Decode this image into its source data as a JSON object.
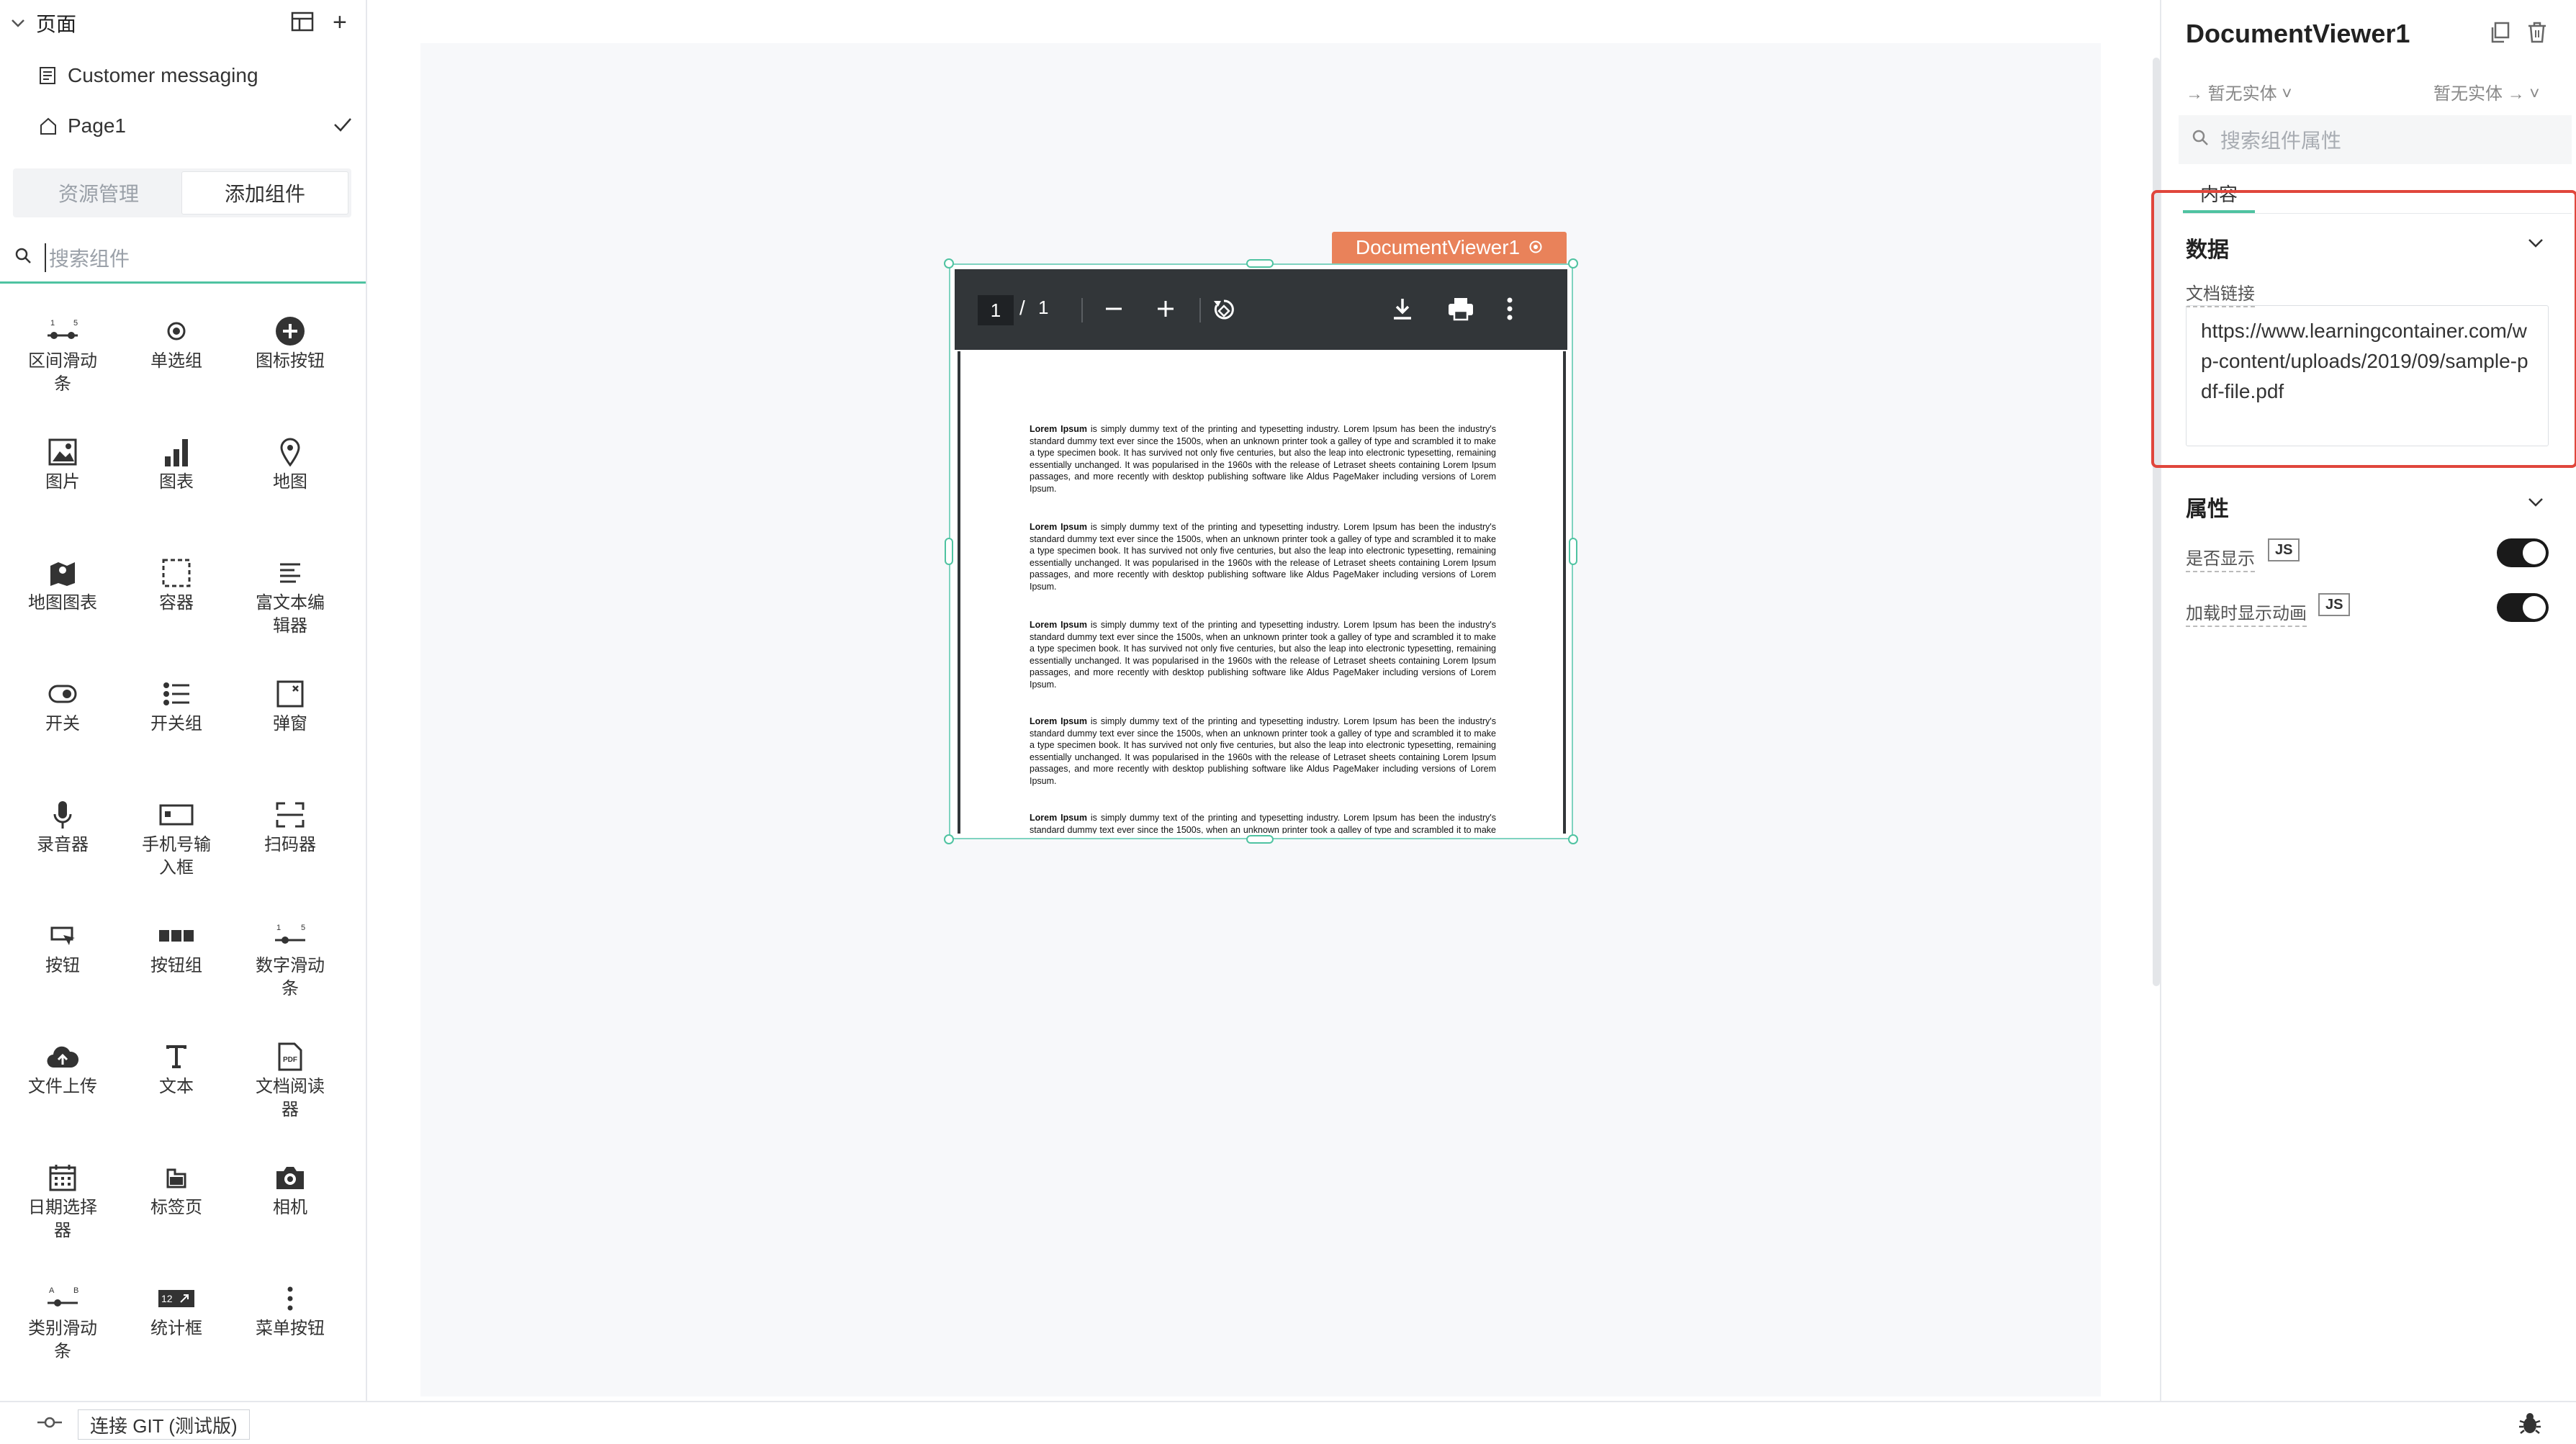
{
  "left": {
    "pages_title": "页面",
    "pages": [
      {
        "label": "Customer messaging",
        "icon": "document-icon"
      },
      {
        "label": "Page1",
        "icon": "home-icon",
        "selected": true
      }
    ],
    "tabs": [
      "资源管理",
      "添加组件"
    ],
    "active_tab": "添加组件",
    "search_placeholder": "搜索组件",
    "components": [
      {
        "label": "区间滑动条",
        "icon": "range-slider-icon"
      },
      {
        "label": "单选组",
        "icon": "radio-icon"
      },
      {
        "label": "图标按钮",
        "icon": "plus-circle-icon"
      },
      {
        "label": "图片",
        "icon": "image-icon"
      },
      {
        "label": "图表",
        "icon": "bar-chart-icon"
      },
      {
        "label": "地图",
        "icon": "map-pin-icon"
      },
      {
        "label": "地图图表",
        "icon": "map-chart-icon"
      },
      {
        "label": "容器",
        "icon": "container-icon"
      },
      {
        "label": "富文本编辑器",
        "icon": "rich-text-icon"
      },
      {
        "label": "开关",
        "icon": "toggle-icon"
      },
      {
        "label": "开关组",
        "icon": "toggle-group-icon"
      },
      {
        "label": "弹窗",
        "icon": "modal-icon"
      },
      {
        "label": "录音器",
        "icon": "microphone-icon"
      },
      {
        "label": "手机号输入框",
        "icon": "phone-input-icon"
      },
      {
        "label": "扫码器",
        "icon": "scanner-icon"
      },
      {
        "label": "按钮",
        "icon": "button-icon"
      },
      {
        "label": "按钮组",
        "icon": "button-group-icon"
      },
      {
        "label": "数字滑动条",
        "icon": "number-slider-icon"
      },
      {
        "label": "文件上传",
        "icon": "upload-cloud-icon"
      },
      {
        "label": "文本",
        "icon": "text-icon"
      },
      {
        "label": "文档阅读器",
        "icon": "pdf-icon"
      },
      {
        "label": "日期选择器",
        "icon": "calendar-icon"
      },
      {
        "label": "标签页",
        "icon": "tabs-icon"
      },
      {
        "label": "相机",
        "icon": "camera-icon"
      },
      {
        "label": "类别滑动条",
        "icon": "category-slider-icon"
      },
      {
        "label": "统计框",
        "icon": "stat-box-icon"
      },
      {
        "label": "菜单按钮",
        "icon": "more-vertical-icon"
      }
    ],
    "slider_marks": {
      "low": "1",
      "high": "5",
      "a": "A",
      "b": "B"
    },
    "stat_value": "12"
  },
  "canvas": {
    "component_tag": "DocumentViewer1",
    "pdf": {
      "page_current": "1",
      "page_sep": "/",
      "page_total": "1",
      "paragraph_lead": "Lorem Ipsum",
      "paragraph_text": " is simply dummy text of the printing and typesetting industry. Lorem Ipsum has been the industry's standard dummy text ever since the 1500s, when an unknown printer took a galley of type and scrambled it to make a type specimen book. It has survived not only five centuries, but also the leap into electronic typesetting, remaining essentially unchanged. It was popularised in the 1960s with the release of Letraset sheets containing Lorem Ipsum passages, and more recently with desktop publishing software like Aldus PageMaker including versions of Lorem Ipsum."
    }
  },
  "right": {
    "title": "DocumentViewer1",
    "entity_left": "暂无实体",
    "entity_right": "暂无实体",
    "search_placeholder": "搜索组件属性",
    "tab_content": "内容",
    "section_data": "数据",
    "doc_link_label": "文档链接",
    "doc_link_value": "https://www.learningcontainer.com/wp-content/uploads/2019/09/sample-pdf-file.pdf",
    "section_props": "属性",
    "prop_visible": "是否显示",
    "prop_animation": "加载时显示动画",
    "js_badge": "JS",
    "visible_on": true,
    "animation_on": true
  },
  "bottom": {
    "git_button": "连接 GIT (测试版)"
  },
  "colors": {
    "accent": "#4fc3a1",
    "tag": "#e9825a",
    "highlight": "#e0463c",
    "pdf_toolbar": "#323639"
  }
}
